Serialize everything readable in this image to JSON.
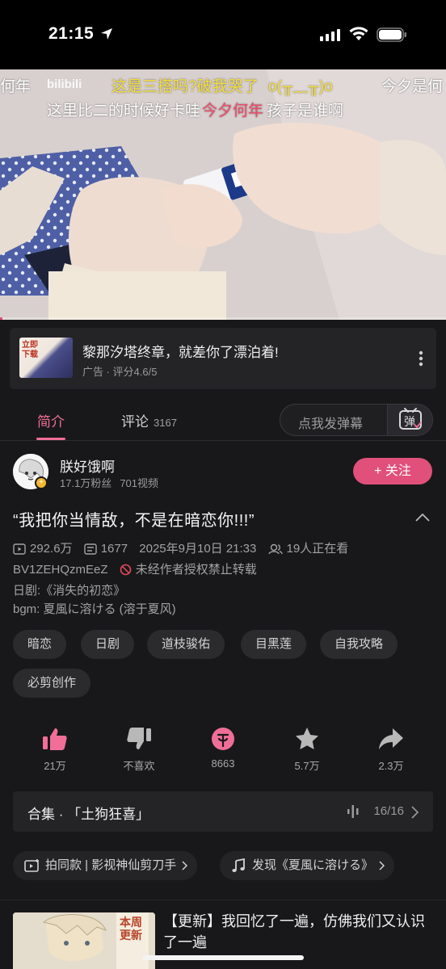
{
  "status_bar": {
    "time": "21:15"
  },
  "video": {
    "watermark": "bilibili",
    "danmaku": [
      "这是三搭吗?破我哭了",
      "o(╥﹏╥)o",
      "今夕是何",
      "何年",
      "这里比二的时候好卡哇",
      "今夕何年",
      "孩子是谁啊"
    ],
    "progress": 0.005
  },
  "ad": {
    "thumb_text": "立即下载",
    "title": "黎那汐塔终章，就差你了漂泊着!",
    "subtitle": "广告 · 评分4.6/5"
  },
  "tabs": {
    "intro": "简介",
    "comments": "评论",
    "comments_count": "3167",
    "danmaku_placeholder": "点我发弹幕",
    "danmaku_button": "弹"
  },
  "uploader": {
    "name": "朕好饿啊",
    "fans": "17.1万粉丝",
    "videos": "701视频",
    "follow": "+ 关注"
  },
  "video_info": {
    "title": "“我把你当情敌，不是在暗恋你!!!”",
    "views": "292.6万",
    "danmaku_count": "1677",
    "date": "2025年9月10日 21:33",
    "watching": "19人正在看",
    "bvid": "BV1ZEHQzmEeZ",
    "copyright": "未经作者授权禁止转载",
    "desc1": "日剧:《消失的初恋》",
    "desc2": "bgm: 夏風に溶ける (溶于夏风)"
  },
  "tags": [
    "暗恋",
    "日剧",
    "道枝骏佑",
    "目黑莲",
    "自我攻略",
    "必剪创作"
  ],
  "actions": {
    "like": "21万",
    "dislike": "不喜欢",
    "coin": "8663",
    "favorite": "5.7万",
    "share": "2.3万"
  },
  "collection": {
    "title": "合集 · 「土狗狂喜」",
    "progress": "16/16"
  },
  "chips": {
    "same_style": "拍同款 | 影视神仙剪刀手",
    "music": "发现《夏風に溶ける》"
  },
  "recommend": {
    "thumb_text": "本周更新",
    "title": "【更新】我回忆了一遍，仿佛我们又认识了一遍"
  },
  "colors": {
    "accent": "#e0507a",
    "tab_active": "#f06e97",
    "background": "#18181a"
  }
}
